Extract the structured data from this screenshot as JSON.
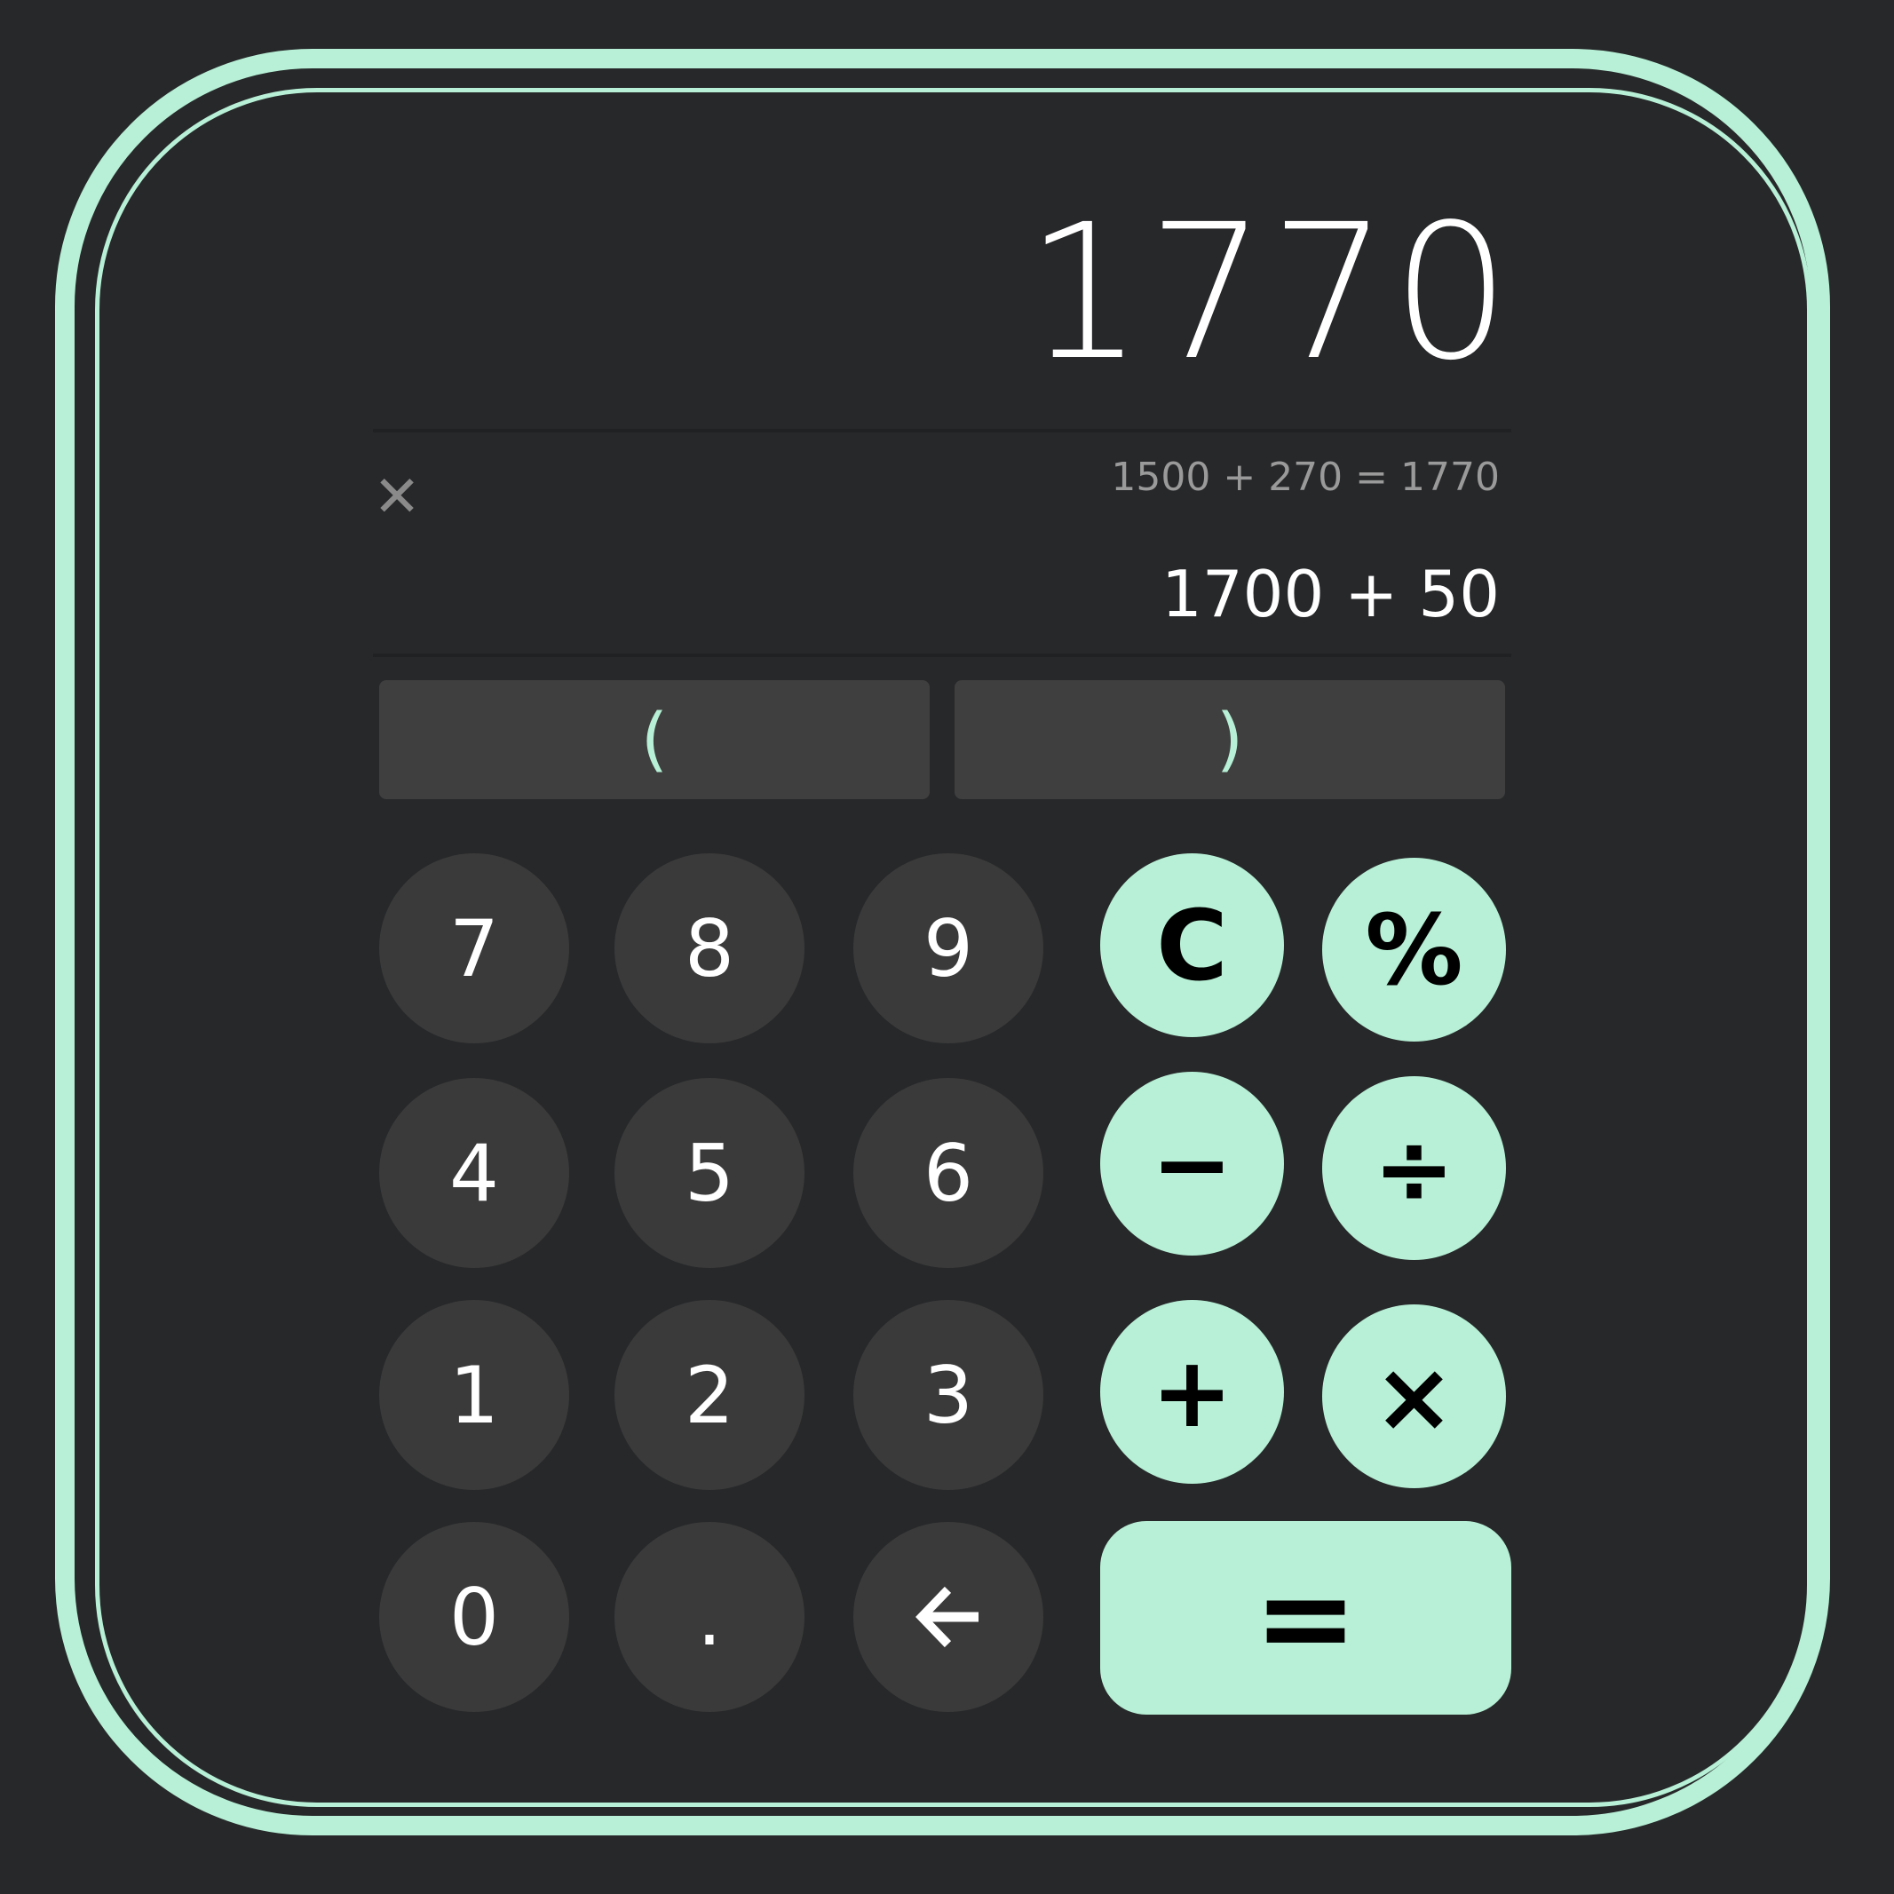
{
  "display": {
    "result": "1770",
    "history": "1500 + 270 = 1770",
    "expression": "1700 + 50"
  },
  "keys": {
    "open_paren": "(",
    "close_paren": ")",
    "seven": "7",
    "eight": "8",
    "nine": "9",
    "four": "4",
    "five": "5",
    "six": "6",
    "one": "1",
    "two": "2",
    "three": "3",
    "zero": "0",
    "decimal": ".",
    "clear": "C",
    "percent": "%",
    "minus": "−",
    "divide": "÷",
    "plus": "+",
    "multiply": "×",
    "equals": "="
  },
  "icons": {
    "close": "close-icon",
    "backspace": "backspace-arrow-icon"
  },
  "colors": {
    "background": "#27282a",
    "accent": "#b7f0d6",
    "number_key": "#3a3a3a",
    "paren_key": "#3f3f3f"
  }
}
